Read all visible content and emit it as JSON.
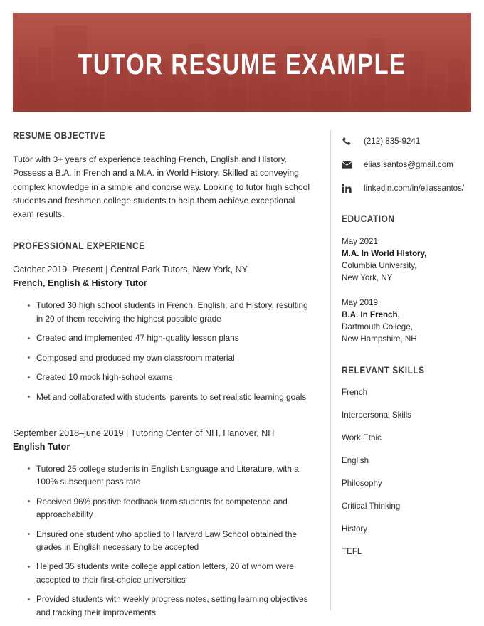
{
  "banner": {
    "title": "TUTOR RESUME EXAMPLE",
    "accent_color": "#a6443c",
    "image_alt": "city-skyline-photo"
  },
  "main": {
    "objective": {
      "heading": "RESUME OBJECTIVE",
      "text": "Tutor with 3+ years of experience teaching French, English and History. Possess a B.A. in French and a M.A. in World History. Skilled at conveying complex knowledge in a simple and concise way. Looking to tutor high school students and freshmen college students to help them achieve exceptional exam results."
    },
    "experience": {
      "heading": "PROFESSIONAL EXPERIENCE",
      "jobs": [
        {
          "date": "October 2019–Present | Central Park Tutors, New York, NY",
          "title": "French, English & History Tutor",
          "bullets": [
            "Tutored 30 high school students in French, English, and History, resulting in 20 of them receiving the highest possible grade",
            "Created and implemented 47 high-quality lesson plans",
            "Composed and produced my own classroom material",
            "Created 10 mock high-school exams",
            "Met and collaborated with students’ parents to set realistic learning goals"
          ]
        },
        {
          "date": "September 2018–june 2019 | Tutoring Center of NH, Hanover, NH",
          "title": "English Tutor",
          "bullets": [
            "Tutored 25 college students in English Language and Literature, with a 100% subsequent pass rate",
            "Received 96% positive feedback from students for competence and approachability",
            "Ensured one student who applied to Harvard Law School obtained the grades in English necessary to be accepted",
            "Helped 35 students write college application letters, 20 of whom were accepted to their first-choice universities",
            "Provided students with weekly progress notes, setting learning objectives and tracking their improvements"
          ]
        }
      ]
    }
  },
  "sidebar": {
    "contact": [
      {
        "icon": "phone-icon",
        "value": "(212) 835-9241"
      },
      {
        "icon": "email-icon",
        "value": "elias.santos@gmail.com"
      },
      {
        "icon": "linkedin-icon",
        "value": "linkedin.com/in/eliassantos/"
      }
    ],
    "education": {
      "heading": "EDUCATION",
      "items": [
        {
          "date": "May 2021",
          "degree": "M.A. In World HIstory,",
          "school": "Columbia University,",
          "location": "New York, NY"
        },
        {
          "date": "May 2019",
          "degree": "B.A. In French,",
          "school": "Dartmouth College,",
          "location": "New Hampshire, NH"
        }
      ]
    },
    "skills": {
      "heading": "RELEVANT SKILLS",
      "items": [
        "French",
        "Interpersonal Skills",
        "Work Ethic",
        "English",
        "Philosophy",
        "Critical Thinking",
        "History",
        "TEFL"
      ]
    }
  }
}
